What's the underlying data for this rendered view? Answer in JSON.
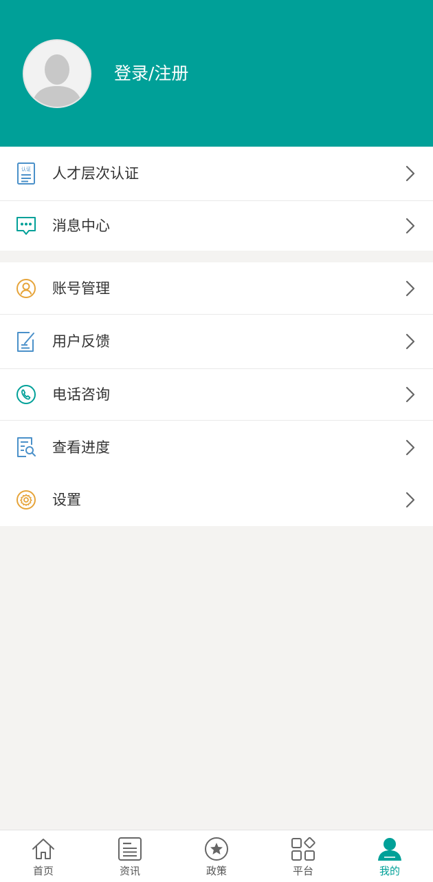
{
  "header": {
    "login_text": "登录/注册"
  },
  "menu": {
    "group1": [
      {
        "label": "人才层次认证",
        "icon": "certificate-icon",
        "icon_text": "认证"
      },
      {
        "label": "消息中心",
        "icon": "message-bubble-icon"
      }
    ],
    "group2": [
      {
        "label": "账号管理",
        "icon": "user-circle-icon"
      },
      {
        "label": "用户反馈",
        "icon": "feedback-edit-icon"
      },
      {
        "label": "电话咨询",
        "icon": "phone-icon"
      },
      {
        "label": "查看进度",
        "icon": "progress-search-icon"
      },
      {
        "label": "设置",
        "icon": "gear-icon"
      }
    ]
  },
  "tabbar": {
    "tabs": [
      {
        "label": "首页",
        "icon": "home-icon"
      },
      {
        "label": "资讯",
        "icon": "news-icon"
      },
      {
        "label": "政策",
        "icon": "star-circle-icon"
      },
      {
        "label": "平台",
        "icon": "apps-grid-icon"
      },
      {
        "label": "我的",
        "icon": "person-icon"
      }
    ],
    "active_index": 4
  },
  "colors": {
    "primary": "#00a098",
    "blue_icon": "#4a90c9",
    "orange_icon": "#e6a43a",
    "text": "#333333",
    "chevron": "#666666",
    "background": "#f4f3f1"
  }
}
